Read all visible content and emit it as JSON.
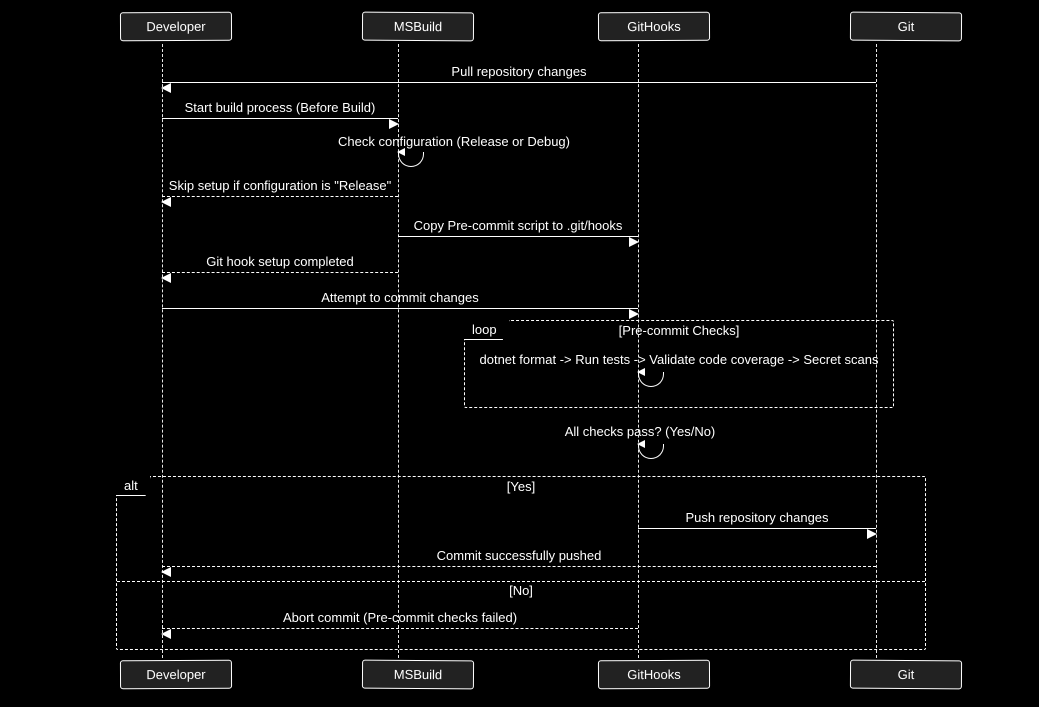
{
  "chart_data": {
    "type": "sequence_diagram",
    "participants": [
      "Developer",
      "MSBuild",
      "GitHooks",
      "Git"
    ],
    "messages": [
      {
        "from": "Git",
        "to": "Developer",
        "text": "Pull repository changes",
        "style": "solid"
      },
      {
        "from": "Developer",
        "to": "MSBuild",
        "text": "Start build process (Before Build)",
        "style": "solid"
      },
      {
        "from": "MSBuild",
        "to": "MSBuild",
        "text": "Check configuration (Release or Debug)",
        "style": "self"
      },
      {
        "from": "MSBuild",
        "to": "Developer",
        "text": "Skip setup if configuration is \"Release\"",
        "style": "dashed"
      },
      {
        "from": "MSBuild",
        "to": "GitHooks",
        "text": "Copy Pre-commit script to .git/hooks",
        "style": "solid"
      },
      {
        "from": "MSBuild",
        "to": "Developer",
        "text": "Git hook setup completed",
        "style": "dashed"
      },
      {
        "from": "Developer",
        "to": "GitHooks",
        "text": "Attempt to commit changes",
        "style": "solid"
      },
      {
        "from": "GitHooks",
        "to": "GitHooks",
        "text": "dotnet format -> Run tests -> Validate code coverage -> Secret scans",
        "style": "self",
        "frame": "loop"
      },
      {
        "from": "GitHooks",
        "to": "GitHooks",
        "text": "All checks pass? (Yes/No)",
        "style": "self"
      },
      {
        "from": "GitHooks",
        "to": "Git",
        "text": "Push repository changes",
        "style": "solid",
        "alt": "Yes"
      },
      {
        "from": "Git",
        "to": "Developer",
        "text": "Commit successfully pushed",
        "style": "dashed",
        "alt": "Yes"
      },
      {
        "from": "GitHooks",
        "to": "Developer",
        "text": "Abort commit (Pre-commit checks failed)",
        "style": "dashed",
        "alt": "No"
      }
    ],
    "frames": [
      {
        "kind": "loop",
        "label": "Pre-commit Checks"
      },
      {
        "kind": "alt",
        "branches": [
          "Yes",
          "No"
        ]
      }
    ]
  },
  "participants": {
    "p0": "Developer",
    "p1": "MSBuild",
    "p2": "GitHooks",
    "p3": "Git"
  },
  "messages": {
    "m0": "Pull repository changes",
    "m1": "Start build process (Before Build)",
    "m2": "Check configuration (Release or Debug)",
    "m3": "Skip setup if configuration is \"Release\"",
    "m4": "Copy Pre-commit script to .git/hooks",
    "m5": "Git hook setup completed",
    "m6": "Attempt to commit changes",
    "m7": "dotnet format -> Run tests -> Validate code coverage -> Secret scans",
    "m8": "All checks pass? (Yes/No)",
    "m9": "Push repository changes",
    "m10": "Commit successfully pushed",
    "m11": "Abort commit (Pre-commit checks failed)"
  },
  "frames": {
    "loop_tag": "loop",
    "loop_title": "[Pre-commit Checks]",
    "alt_tag": "alt",
    "alt_yes": "[Yes]",
    "alt_no": "[No]"
  }
}
